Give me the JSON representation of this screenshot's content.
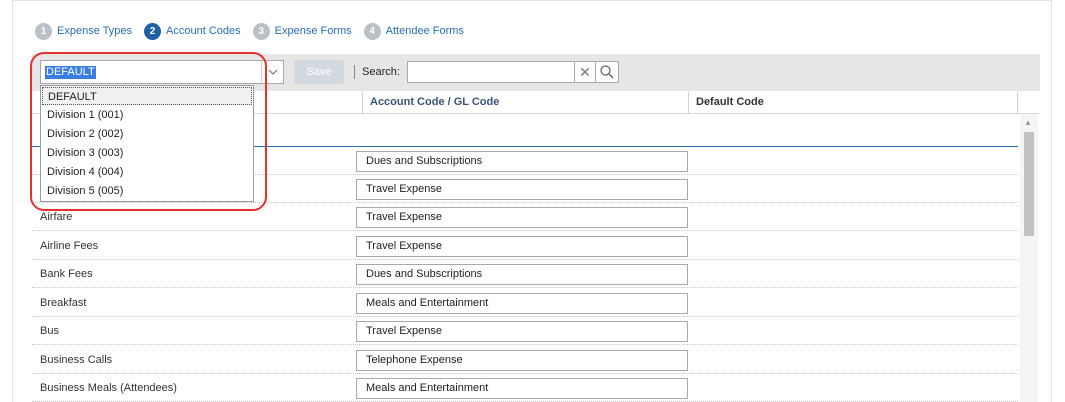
{
  "steps": [
    {
      "num": "1",
      "label": "Expense Types"
    },
    {
      "num": "2",
      "label": "Account Codes"
    },
    {
      "num": "3",
      "label": "Expense Forms"
    },
    {
      "num": "4",
      "label": "Attendee Forms"
    }
  ],
  "toolbar": {
    "select_value": "DEFAULT",
    "save_label": "Save",
    "search_label": "Search:",
    "search_value": ""
  },
  "dropdown": {
    "options": [
      "DEFAULT",
      "Division 1 (001)",
      "Division 2 (002)",
      "Division 3 (003)",
      "Division 4 (004)",
      "Division 5 (005)"
    ]
  },
  "columns": {
    "account_code": "Account Code / GL Code",
    "default_code": "Default Code"
  },
  "rows": [
    {
      "name": "",
      "code": "Dues and Subscriptions"
    },
    {
      "name": "",
      "code": "Travel Expense"
    },
    {
      "name": "Airfare",
      "code": "Travel Expense"
    },
    {
      "name": "Airline Fees",
      "code": "Travel Expense"
    },
    {
      "name": "Bank Fees",
      "code": "Dues and Subscriptions"
    },
    {
      "name": "Breakfast",
      "code": "Meals and Entertainment"
    },
    {
      "name": "Bus",
      "code": "Travel Expense"
    },
    {
      "name": "Business Calls",
      "code": "Telephone Expense"
    },
    {
      "name": "Business Meals (Attendees)",
      "code": "Meals and Entertainment"
    }
  ],
  "colors": {
    "accent": "#1f5fa3",
    "highlight_ring": "#e53030",
    "toolbar_bg": "#e6e6e6"
  }
}
